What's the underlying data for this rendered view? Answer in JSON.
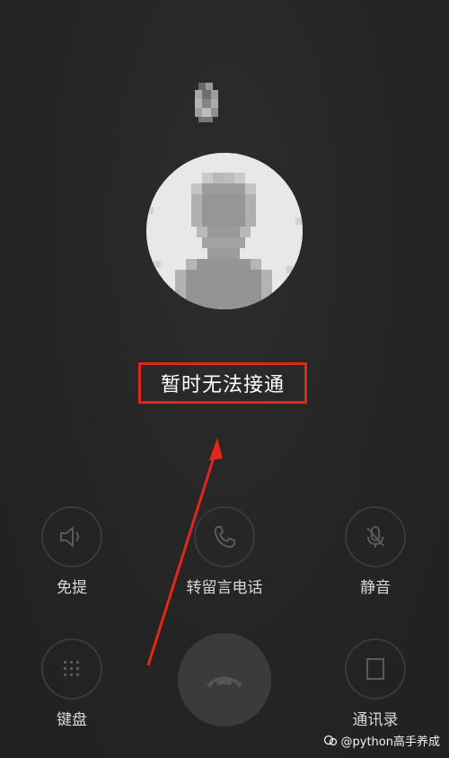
{
  "call": {
    "status": "暂时无法接通"
  },
  "controls": {
    "speaker": "免提",
    "voicemail": "转留言电话",
    "mute": "静音",
    "keypad": "键盘",
    "contacts": "通讯录"
  },
  "watermark": {
    "text": "@python高手养成"
  },
  "colors": {
    "background": "#242424",
    "highlight_box": "#e3261c",
    "arrow": "#e3261c",
    "label": "#d8d8d8"
  },
  "icons": {
    "speaker": "speaker-icon",
    "voicemail": "phone-icon",
    "mute": "mute-icon",
    "keypad": "keypad-icon",
    "hangup": "hangup-icon",
    "contacts": "contacts-icon"
  }
}
